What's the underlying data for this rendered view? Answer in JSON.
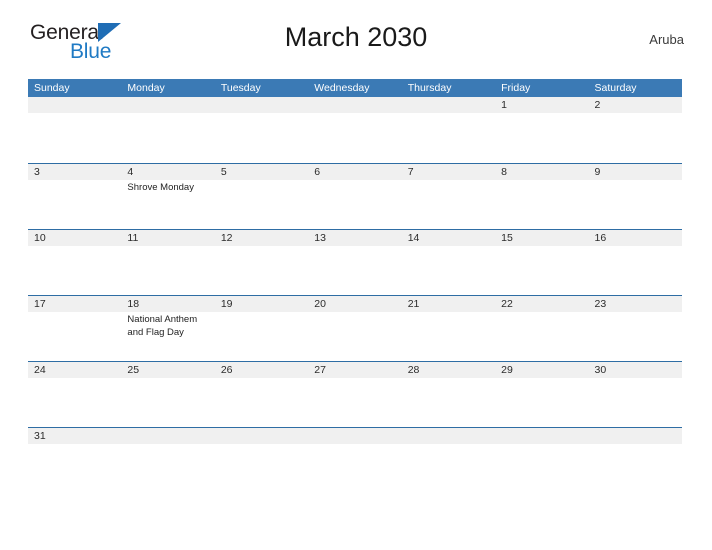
{
  "logo": {
    "word1": "General",
    "word2": "Blue",
    "triangle_icon": "blue-triangle-icon",
    "word1_color": "#231f20",
    "word2_color": "#1f7ac4",
    "triangle_color": "#1f6db5"
  },
  "header": {
    "title": "March 2030",
    "country": "Aruba"
  },
  "colors": {
    "header_blue": "#3b7ab5",
    "row_rule_blue": "#2e6da4",
    "date_band_gray": "#f0f0f0",
    "text_dark": "#2b2b2b"
  },
  "weekdays": [
    "Sunday",
    "Monday",
    "Tuesday",
    "Wednesday",
    "Thursday",
    "Friday",
    "Saturday"
  ],
  "weeks": [
    {
      "days": [
        {
          "date": "",
          "events": []
        },
        {
          "date": "",
          "events": []
        },
        {
          "date": "",
          "events": []
        },
        {
          "date": "",
          "events": []
        },
        {
          "date": "",
          "events": []
        },
        {
          "date": "1",
          "events": []
        },
        {
          "date": "2",
          "events": []
        }
      ]
    },
    {
      "days": [
        {
          "date": "3",
          "events": []
        },
        {
          "date": "4",
          "events": [
            "Shrove Monday"
          ]
        },
        {
          "date": "5",
          "events": []
        },
        {
          "date": "6",
          "events": []
        },
        {
          "date": "7",
          "events": []
        },
        {
          "date": "8",
          "events": []
        },
        {
          "date": "9",
          "events": []
        }
      ]
    },
    {
      "days": [
        {
          "date": "10",
          "events": []
        },
        {
          "date": "11",
          "events": []
        },
        {
          "date": "12",
          "events": []
        },
        {
          "date": "13",
          "events": []
        },
        {
          "date": "14",
          "events": []
        },
        {
          "date": "15",
          "events": []
        },
        {
          "date": "16",
          "events": []
        }
      ]
    },
    {
      "days": [
        {
          "date": "17",
          "events": []
        },
        {
          "date": "18",
          "events": [
            "National Anthem and Flag Day"
          ]
        },
        {
          "date": "19",
          "events": []
        },
        {
          "date": "20",
          "events": []
        },
        {
          "date": "21",
          "events": []
        },
        {
          "date": "22",
          "events": []
        },
        {
          "date": "23",
          "events": []
        }
      ]
    },
    {
      "days": [
        {
          "date": "24",
          "events": []
        },
        {
          "date": "25",
          "events": []
        },
        {
          "date": "26",
          "events": []
        },
        {
          "date": "27",
          "events": []
        },
        {
          "date": "28",
          "events": []
        },
        {
          "date": "29",
          "events": []
        },
        {
          "date": "30",
          "events": []
        }
      ]
    },
    {
      "days": [
        {
          "date": "31",
          "events": []
        },
        {
          "date": "",
          "events": []
        },
        {
          "date": "",
          "events": []
        },
        {
          "date": "",
          "events": []
        },
        {
          "date": "",
          "events": []
        },
        {
          "date": "",
          "events": []
        },
        {
          "date": "",
          "events": []
        }
      ]
    }
  ]
}
